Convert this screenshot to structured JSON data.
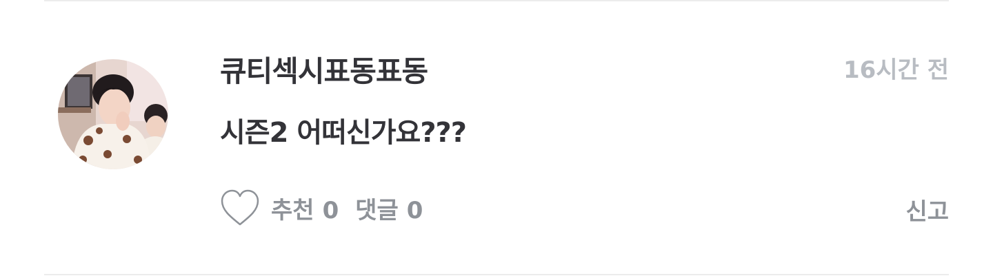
{
  "comment": {
    "username": "큐티섹시표동표동",
    "timestamp": "16시간 전",
    "text": "시즌2 어떠신가요???",
    "actions": {
      "like_label": "추천",
      "like_count": "0",
      "comment_label": "댓글",
      "comment_count": "0",
      "report_label": "신고"
    }
  },
  "colors": {
    "text_primary": "#333338",
    "text_muted": "#8e9298",
    "timestamp": "#b8bcc2",
    "divider": "#ececec",
    "heart_stroke": "#8e9298"
  },
  "icons": {
    "like": "heart-icon",
    "avatar": "user-avatar-photo"
  }
}
